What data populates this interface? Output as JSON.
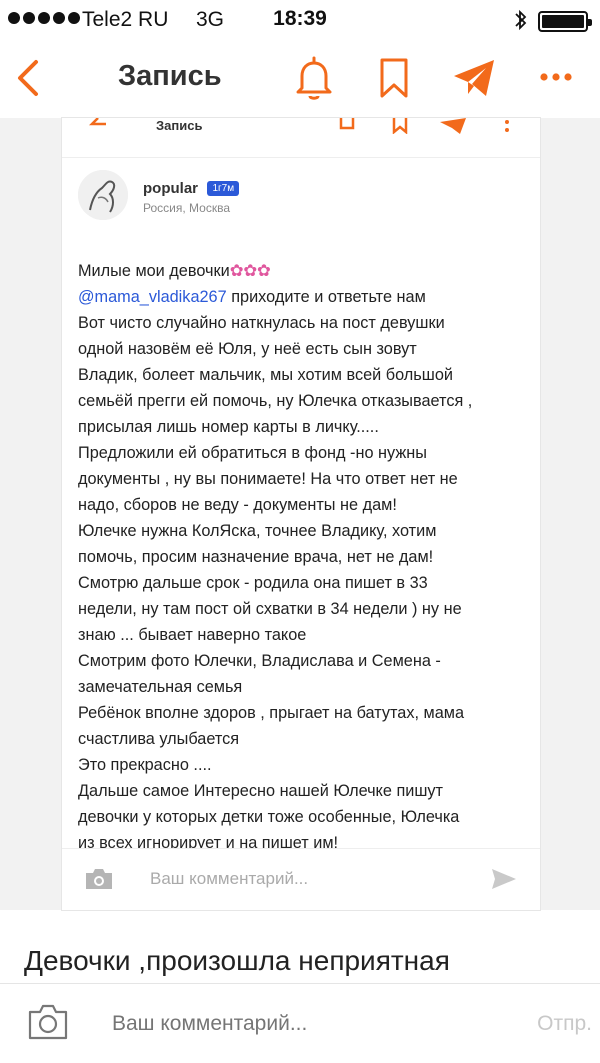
{
  "status_bar": {
    "carrier": "Tele2 RU",
    "network": "3G",
    "time": "18:39"
  },
  "nav": {
    "title": "Запись",
    "icons": [
      "back-arrow-icon",
      "bell-icon",
      "bookmark-icon",
      "share-plane-icon",
      "more-dots-icon"
    ],
    "accent_color": "#f26a1b"
  },
  "embedded": {
    "header_title": "Запись",
    "author_name": "popular",
    "author_badge": "1г7м",
    "author_location": "Россия, Москва",
    "post_lines": [
      "Милые мои девочки",
      "@mama_vladika267 приходите и ответьте нам",
      "Вот чисто случайно наткнулась на пост девушки",
      "одной назовём её Юля, у неё есть сын зовут",
      "Владик, болеет мальчик, мы хотим всей большой",
      "семьёй прегги ей помочь, ну Юлечка отказывается ,",
      "присылая лишь номер карты в личку.....",
      "Предложили ей обратиться в фонд -но нужны",
      "документы , ну вы понимаете! На что ответ нет не",
      "надо, сборов не веду - документы не дам!",
      "Юлечке нужна КолЯска, точнее Владику, хотим",
      "помочь, просим назначение врача, нет не дам!",
      "Смотрю дальше срок - родила она пишет в 33",
      "недели, ну там пост ой схватки в 34 недели ) ну не",
      "знаю ... бывает наверно такое",
      "Смотрим фото Юлечки, Владислава и Семена -",
      "замечательная семья",
      "Ребёнок вполне здоров , прыгает на батутах, мама",
      "счастлива улыбается",
      "Это прекрасно ....",
      "Дальше самое Интересно нашей Юлечке пишут",
      "девочки у которых детки тоже особенные, Юлечка",
      "из всех игнорирует и на пишет им!"
    ],
    "flowers": "✿✿✿",
    "comment_placeholder": "Ваш комментарий..."
  },
  "next_post_title": "Девочки ,произошла неприятная",
  "bottom_bar": {
    "comment_placeholder": "Ваш комментарий...",
    "send_label": "Отпр."
  }
}
